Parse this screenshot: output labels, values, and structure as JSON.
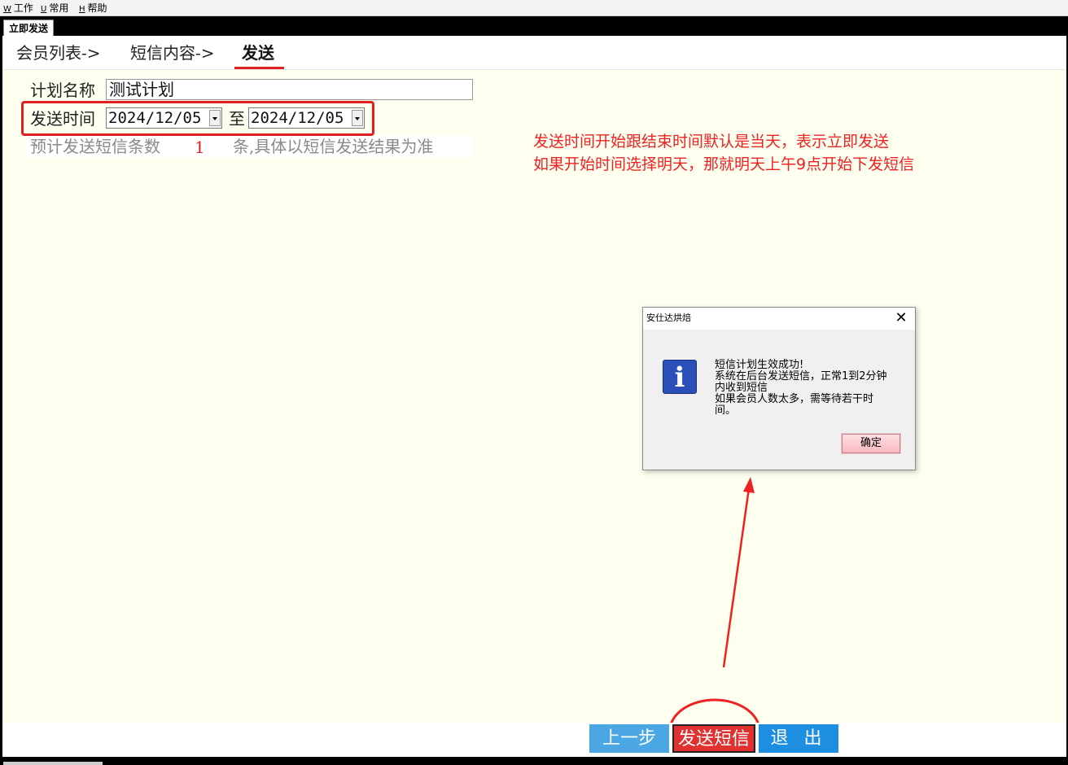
{
  "menu": {
    "items": [
      {
        "key": "W",
        "label": "工作"
      },
      {
        "key": "U",
        "label": "常用"
      },
      {
        "key": "H",
        "label": "帮助"
      }
    ]
  },
  "window": {
    "tab_title": "立即发送"
  },
  "wizard": {
    "steps": [
      "会员列表->",
      "短信内容->",
      "发送"
    ],
    "active_step": "发送"
  },
  "form": {
    "plan_name_label": "计划名称",
    "plan_name_value": "测试计划",
    "send_time_label": "发送时间",
    "start_date": "2024/12/05",
    "to_label": "至",
    "end_date": "2024/12/05",
    "estimate_label": "预计发送短信条数",
    "estimate_count": "1",
    "estimate_suffix": "条,具体以短信发送结果为准"
  },
  "annotation": {
    "line1": "发送时间开始跟结束时间默认是当天，表示立即发送",
    "line2": "如果开始时间选择明天，那就明天上午9点开始下发短信",
    "color": "#ee2222"
  },
  "dialog": {
    "title": "安仕达烘焙",
    "close_glyph": "✕",
    "icon": "info-icon",
    "icon_glyph": "i",
    "message_lines": [
      "短信计划生效成功!",
      "系统在后台发送短信，正常1到2分钟",
      "内收到短信",
      "如果会员人数太多，需等待若干时",
      "间。"
    ],
    "ok_label": "确定"
  },
  "buttons": {
    "prev_label": "上一步",
    "send_label": "发送短信",
    "exit_label": "退 出"
  },
  "colors": {
    "content_bg": "#fffff0",
    "prev_btn": "#4ba6e4",
    "send_btn": "#e03030",
    "exit_btn": "#1e8fe0",
    "highlight": "#e02020"
  }
}
